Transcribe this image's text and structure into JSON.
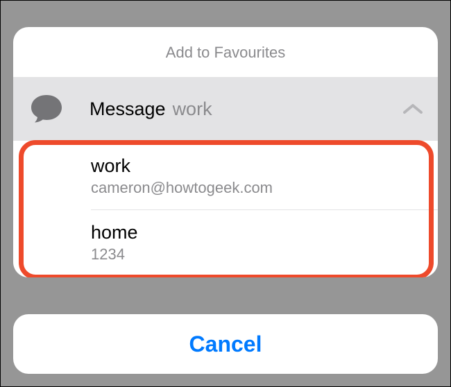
{
  "sheet": {
    "title": "Add to Favourites"
  },
  "message": {
    "label": "Message",
    "sublabel": "work"
  },
  "options": [
    {
      "label": "work",
      "value": "cameron@howtogeek.com"
    },
    {
      "label": "home",
      "value": "1234"
    }
  ],
  "cancel": {
    "label": "Cancel"
  },
  "colors": {
    "accent": "#007aff",
    "highlight": "#ee4a2b"
  }
}
